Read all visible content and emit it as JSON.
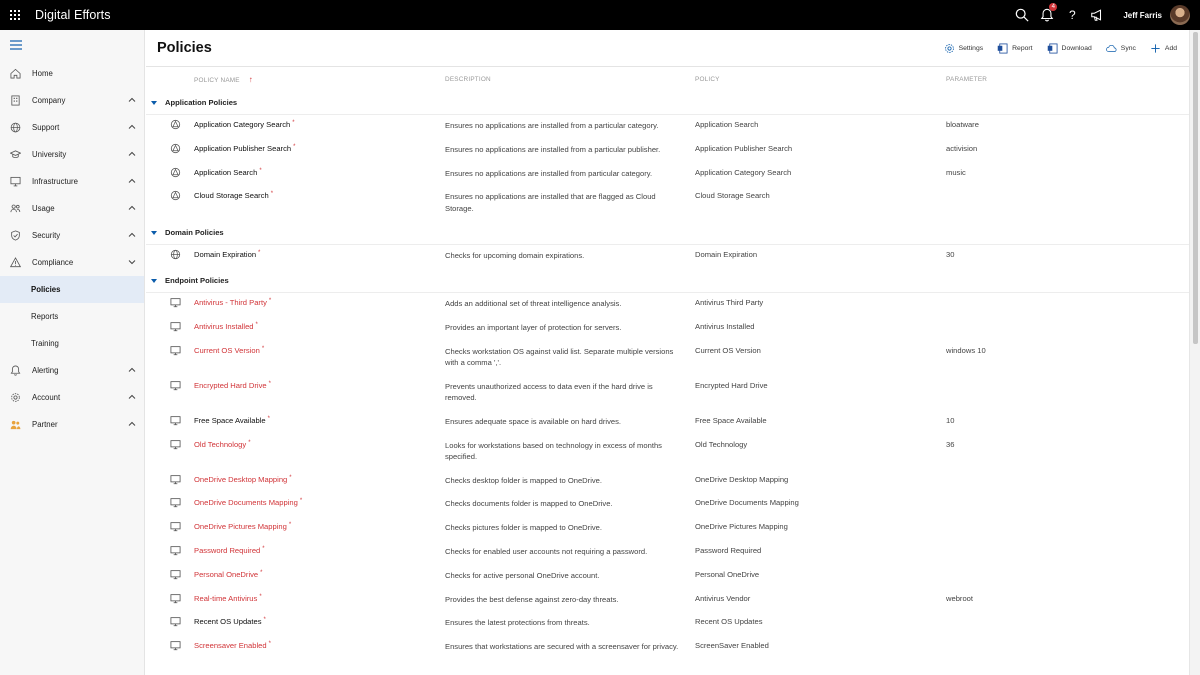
{
  "app": {
    "title": "Digital Efforts"
  },
  "topbar": {
    "notification_count": "4",
    "help_glyph": "?",
    "user_name": "Jeff Farris"
  },
  "sidebar": {
    "items": [
      {
        "label": "Home",
        "icon": "home-icon",
        "expandable": false
      },
      {
        "label": "Company",
        "icon": "building-icon",
        "expandable": true
      },
      {
        "label": "Support",
        "icon": "globe-icon",
        "expandable": true
      },
      {
        "label": "University",
        "icon": "graduation-cap-icon",
        "expandable": true
      },
      {
        "label": "Infrastructure",
        "icon": "monitor-icon",
        "expandable": true
      },
      {
        "label": "Usage",
        "icon": "people-icon",
        "expandable": true
      },
      {
        "label": "Security",
        "icon": "shield-icon",
        "expandable": true
      },
      {
        "label": "Compliance",
        "icon": "warning-icon",
        "expandable": true
      }
    ],
    "compliance_sub": [
      "Policies",
      "Reports",
      "Training"
    ],
    "items_after": [
      {
        "label": "Alerting",
        "icon": "bell-icon",
        "expandable": true
      },
      {
        "label": "Account",
        "icon": "gear-icon",
        "expandable": true
      },
      {
        "label": "Partner",
        "icon": "partner-icon",
        "expandable": true
      }
    ]
  },
  "page": {
    "title": "Policies",
    "commands": [
      "Settings",
      "Report",
      "Download",
      "Sync",
      "Add"
    ]
  },
  "columns": {
    "name": "POLICY NAME",
    "sort_arrow": "↑",
    "description": "DESCRIPTION",
    "policy": "POLICY",
    "parameter": "PARAMETER"
  },
  "groups": [
    {
      "name": "Application Policies",
      "rows": [
        {
          "name": "Application Category Search",
          "required": "*",
          "desc": "Ensures no applications are installed from a particular category.",
          "policy": "Application Search",
          "param": "bloatware",
          "icon": "app-icon",
          "alert": false
        },
        {
          "name": "Application Publisher Search",
          "required": "*",
          "desc": "Ensures no applications are installed from a particular publisher.",
          "policy": "Application Publisher Search",
          "param": "activision",
          "icon": "app-icon",
          "alert": false
        },
        {
          "name": "Application Search",
          "required": "*",
          "desc": "Ensures no applications are installed from particular category.",
          "policy": "Application Category Search",
          "param": "music",
          "icon": "app-icon",
          "alert": false
        },
        {
          "name": "Cloud Storage Search",
          "required": "*",
          "desc": "Ensures no applications are installed that are flagged as Cloud Storage.",
          "policy": "Cloud Storage Search",
          "param": "",
          "icon": "app-icon",
          "alert": false,
          "tall": true
        }
      ]
    },
    {
      "name": "Domain Policies",
      "rows": [
        {
          "name": "Domain Expiration",
          "required": "*",
          "desc": "Checks for upcoming domain expirations.",
          "policy": "Domain Expiration",
          "param": "30",
          "icon": "globe-icon",
          "alert": false
        }
      ]
    },
    {
      "name": "Endpoint Policies",
      "rows": [
        {
          "name": "Antivirus - Third Party",
          "required": "*",
          "desc": "Adds an additional set of threat intelligence analysis.",
          "policy": "Antivirus Third Party",
          "param": "",
          "icon": "monitor-icon",
          "alert": true
        },
        {
          "name": "Antivirus Installed",
          "required": "*",
          "desc": "Provides an important layer of protection for servers.",
          "policy": "Antivirus Installed",
          "param": "",
          "icon": "monitor-icon",
          "alert": true
        },
        {
          "name": "Current OS Version",
          "required": "*",
          "desc": "Checks workstation OS against valid list. Separate multiple versions with a comma ','.",
          "policy": "Current OS Version",
          "param": "windows 10",
          "icon": "monitor-icon",
          "alert": true,
          "tall": true
        },
        {
          "name": "Encrypted Hard Drive",
          "required": "*",
          "desc": "Prevents unauthorized access to data even if the hard drive is removed.",
          "policy": "Encrypted Hard Drive",
          "param": "",
          "icon": "monitor-icon",
          "alert": true,
          "tall": true
        },
        {
          "name": "Free Space Available",
          "required": "*",
          "desc": "Ensures adequate space is available on hard drives.",
          "policy": "Free Space Available",
          "param": "10",
          "icon": "monitor-icon",
          "alert": false
        },
        {
          "name": "Old Technology",
          "required": "*",
          "desc": "Looks for workstations based on technology in excess of months specified.",
          "policy": "Old Technology",
          "param": "36",
          "icon": "monitor-icon",
          "alert": true,
          "tall": true
        },
        {
          "name": "OneDrive Desktop Mapping",
          "required": "*",
          "desc": "Checks desktop folder is mapped to OneDrive.",
          "policy": "OneDrive Desktop Mapping",
          "param": "",
          "icon": "monitor-icon",
          "alert": true
        },
        {
          "name": "OneDrive Documents Mapping",
          "required": "*",
          "desc": "Checks documents folder is mapped to OneDrive.",
          "policy": "OneDrive Documents Mapping",
          "param": "",
          "icon": "monitor-icon",
          "alert": true
        },
        {
          "name": "OneDrive Pictures Mapping",
          "required": "*",
          "desc": "Checks pictures folder is mapped to OneDrive.",
          "policy": "OneDrive Pictures Mapping",
          "param": "",
          "icon": "monitor-icon",
          "alert": true
        },
        {
          "name": "Password Required",
          "required": "*",
          "desc": "Checks for enabled user accounts not requiring a password.",
          "policy": "Password Required",
          "param": "",
          "icon": "monitor-icon",
          "alert": true
        },
        {
          "name": "Personal OneDrive",
          "required": "*",
          "desc": "Checks for active personal OneDrive account.",
          "policy": "Personal OneDrive",
          "param": "",
          "icon": "monitor-icon",
          "alert": true
        },
        {
          "name": "Real-time Antivirus",
          "required": "*",
          "desc": "Provides the best defense against zero-day threats.",
          "policy": "Antivirus Vendor",
          "param": "webroot",
          "icon": "monitor-icon",
          "alert": true
        },
        {
          "name": "Recent OS Updates",
          "required": "*",
          "desc": "Ensures the latest protections from threats.",
          "policy": "Recent OS Updates",
          "param": "",
          "icon": "monitor-icon",
          "alert": false
        },
        {
          "name": "Screensaver Enabled",
          "required": "*",
          "desc": "Ensures that workstations are secured with a screensaver for privacy.",
          "policy": "ScreenSaver Enabled",
          "param": "",
          "icon": "monitor-icon",
          "alert": true,
          "tall": true
        }
      ]
    }
  ],
  "colors": {
    "alert_red": "#d13438",
    "accent_blue": "#0b5cab",
    "topbar": "#000000"
  }
}
